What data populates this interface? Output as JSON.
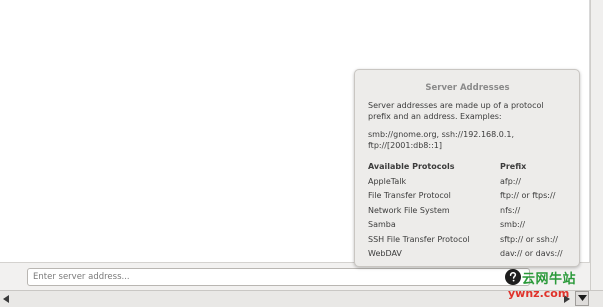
{
  "address_bar": {
    "placeholder": "Enter server address..."
  },
  "popover": {
    "title": "Server Addresses",
    "description": "Server addresses are made up of a protocol prefix and an address. Examples:",
    "examples": "smb://gnome.org, ssh://192.168.0.1, ftp://[2001:db8::1]",
    "headers": {
      "protocols": "Available Protocols",
      "prefix": "Prefix"
    },
    "rows": [
      {
        "name": "AppleTalk",
        "prefix": "afp://"
      },
      {
        "name": "File Transfer Protocol",
        "prefix": "ftp:// or ftps://"
      },
      {
        "name": "Network File System",
        "prefix": "nfs://"
      },
      {
        "name": "Samba",
        "prefix": "smb://"
      },
      {
        "name": "SSH File Transfer Protocol",
        "prefix": "sftp:// or ssh://"
      },
      {
        "name": "WebDAV",
        "prefix": "dav:// or davs://"
      }
    ]
  },
  "watermark": {
    "chinese": "云网牛站",
    "domain": "ywnz.com"
  },
  "icons": {
    "help": "help-icon",
    "scroll_left": "arrow-left-icon",
    "scroll_right": "arrow-right-icon",
    "scroll_down": "chevron-down-icon"
  }
}
